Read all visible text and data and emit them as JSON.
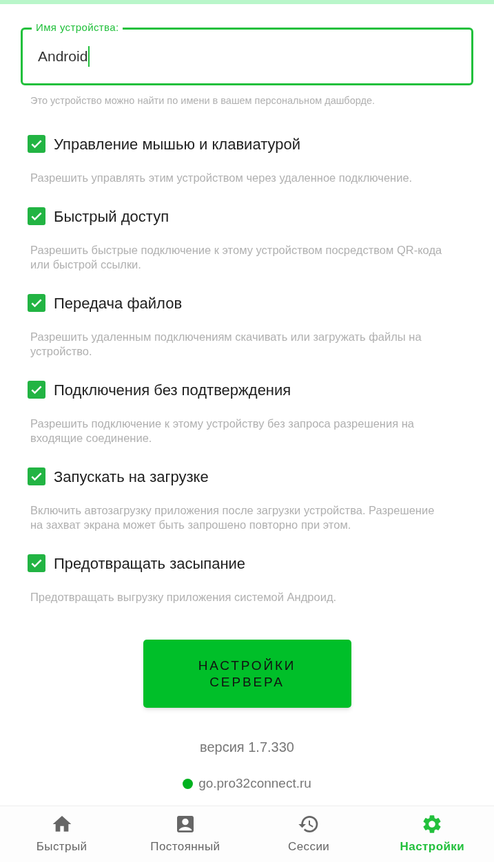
{
  "device_name": {
    "label": "Имя устройства:",
    "value": "Android",
    "focused": true,
    "helper": "Это устройство можно найти по имени в вашем персональном дашборде."
  },
  "options": [
    {
      "label": "Управление мышью и клавиатурой",
      "checked": true,
      "description": "Разрешить управлять этим устройством через удаленное подключение."
    },
    {
      "label": "Быстрый доступ",
      "checked": true,
      "description": "Разрешить быстрые подключение к этому устройством посредством QR-кода или быстрой ссылки."
    },
    {
      "label": "Передача файлов",
      "checked": true,
      "description": "Разрешить удаленным подключениям скачивать или загружать файлы на устройство."
    },
    {
      "label": "Подключения без подтверждения",
      "checked": true,
      "description": "Разрешить подключение к этому устройству без запроса разрешения на входящие соединение."
    },
    {
      "label": "Запускать на загрузке",
      "checked": true,
      "description": "Включить автозагрузку приложения после загрузки устройства. Разрешение на захват экрана может быть запрошено повторно при этом."
    },
    {
      "label": "Предотвращать засыпание",
      "checked": true,
      "description": "Предотвращать выгрузку приложения системой Андроид."
    }
  ],
  "server_button": "НАСТРОЙКИ СЕРВЕРА",
  "version": "версия 1.7.330",
  "server": {
    "address": "go.pro32connect.ru",
    "connected": true
  },
  "nav": [
    {
      "kind": "home",
      "label": "Быстрый",
      "selected": false
    },
    {
      "kind": "contact",
      "label": "Постоянный",
      "selected": false
    },
    {
      "kind": "history",
      "label": "Сессии",
      "selected": false
    },
    {
      "kind": "settings",
      "label": "Настройки",
      "selected": true
    }
  ]
}
